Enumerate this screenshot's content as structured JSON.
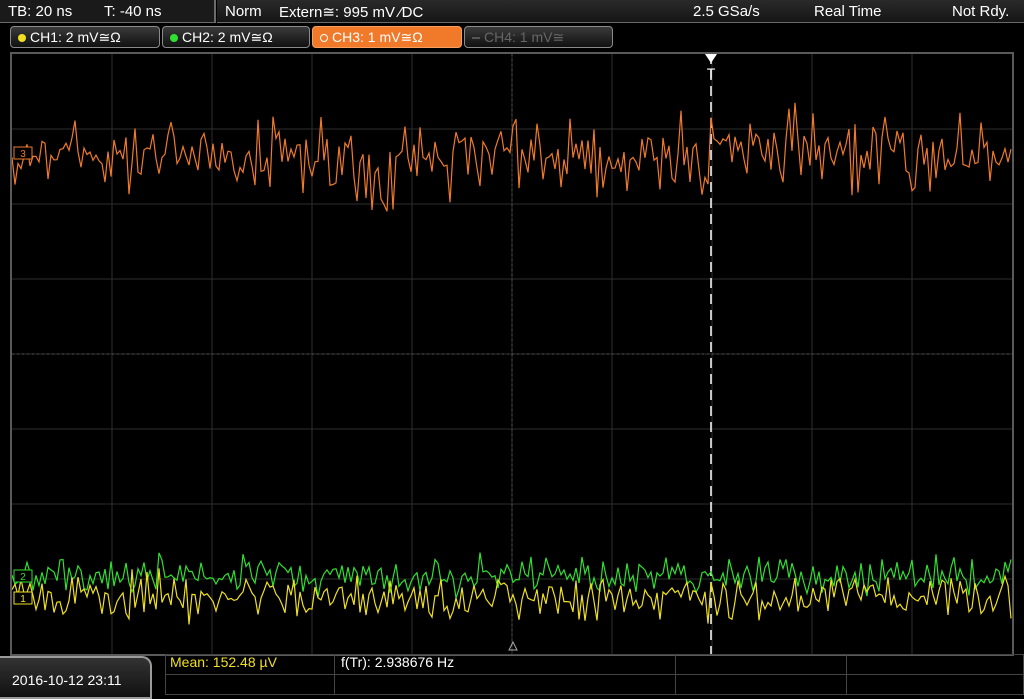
{
  "topbar": {
    "timebase": "TB: 20 ns",
    "trigger_time": "T: -40 ns",
    "trigger_mode": "Norm",
    "trigger_source": "Extern≅: 995 mV ⁄DC",
    "sample_rate": "2.5 GSa/s",
    "acq_mode": "Real Time",
    "status": "Not Rdy."
  },
  "channels": [
    {
      "label": "CH1: 2 mV≅Ω",
      "color": "#f0e020",
      "state": "on"
    },
    {
      "label": "CH2: 2 mV≅Ω",
      "color": "#30e030",
      "state": "on"
    },
    {
      "label": "CH3: 1 mV≅Ω",
      "color": "#f07a2a",
      "state": "selected"
    },
    {
      "label": "CH4: 1 mV≅",
      "color": "#555555",
      "state": "off"
    }
  ],
  "screen": {
    "trigger_marker": "T",
    "ch3_marker": "3",
    "ch2_marker": "2",
    "ch1_marker": "1",
    "grid_color": "#2e2e2e",
    "grid_line_color": "#555555",
    "trigger_line_color": "#ffffff"
  },
  "bottom": {
    "datetime": "2016-10-12 23:11",
    "mean": "Mean: 152.48 µV",
    "freq": "f(Tr): 2.938676 Hz",
    "mean_color": "#f0e020"
  }
}
